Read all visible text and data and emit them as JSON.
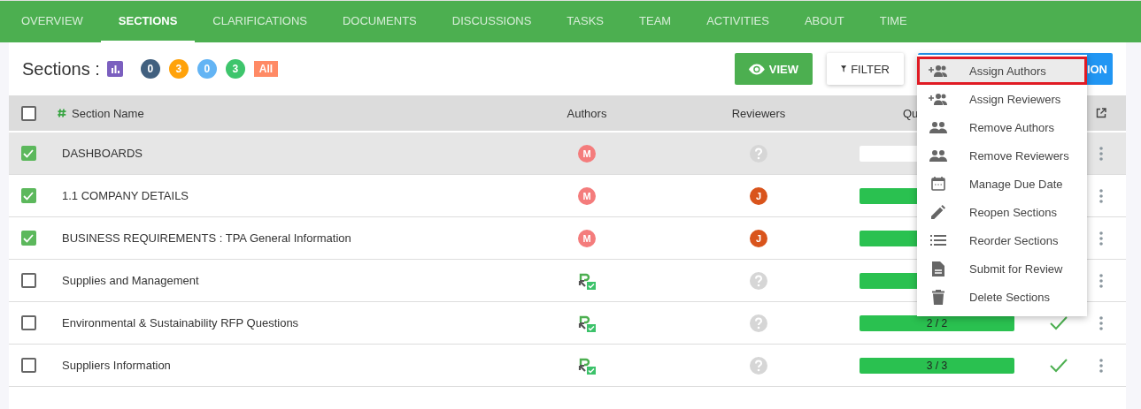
{
  "tabs": [
    {
      "label": "OVERVIEW",
      "selected": false
    },
    {
      "label": "SECTIONS",
      "selected": true
    },
    {
      "label": "CLARIFICATIONS",
      "selected": false
    },
    {
      "label": "DOCUMENTS",
      "selected": false
    },
    {
      "label": "DISCUSSIONS",
      "selected": false
    },
    {
      "label": "TASKS",
      "selected": false
    },
    {
      "label": "TEAM",
      "selected": false
    },
    {
      "label": "ACTIVITIES",
      "selected": false
    },
    {
      "label": "ABOUT",
      "selected": false
    },
    {
      "label": "TIME",
      "selected": false
    }
  ],
  "header": {
    "title": "Sections :",
    "badges": [
      {
        "kind": "count",
        "label": "0",
        "color": "#41607f"
      },
      {
        "kind": "count",
        "label": "3",
        "color": "#ffa20a"
      },
      {
        "kind": "count",
        "label": "0",
        "color": "#63b4f4"
      },
      {
        "kind": "count",
        "label": "3",
        "color": "#3ec56c"
      },
      {
        "kind": "tag",
        "label": "All",
        "color": "#ff8a65"
      }
    ],
    "buttons": [
      {
        "kind": "view",
        "label": "VIEW"
      },
      {
        "kind": "filter",
        "label": "FILTER"
      },
      {
        "kind": "action",
        "label": "ION"
      }
    ]
  },
  "table": {
    "select_all": {
      "checked": false
    },
    "columns": [
      "Section Name",
      "Authors",
      "Reviewers",
      "Qu"
    ],
    "rows": [
      {
        "checked": true,
        "hovered": true,
        "name": "DASHBOARDS",
        "author": {
          "kind": "avatar",
          "initial": "M",
          "color": "#f47c7c"
        },
        "reviewer": {
          "kind": "unknown"
        },
        "progress": {
          "level": 0
        }
      },
      {
        "checked": true,
        "hovered": false,
        "name": "1.1 COMPANY DETAILS",
        "author": {
          "kind": "avatar",
          "initial": "M",
          "color": "#f47c7c"
        },
        "reviewer": {
          "kind": "avatar",
          "initial": "J",
          "color": "#d9541c"
        },
        "progress": {
          "level": 1
        }
      },
      {
        "checked": true,
        "hovered": false,
        "name": "BUSINESS REQUIREMENTS : TPA General Information",
        "author": {
          "kind": "avatar",
          "initial": "M",
          "color": "#f47c7c"
        },
        "reviewer": {
          "kind": "avatar",
          "initial": "J",
          "color": "#d9541c"
        },
        "progress": {
          "level": 1
        }
      },
      {
        "checked": false,
        "hovered": false,
        "name": "Supplies and Management",
        "author": {
          "kind": "assign"
        },
        "reviewer": {
          "kind": "unknown"
        },
        "progress": {
          "level": 1
        }
      },
      {
        "checked": false,
        "hovered": false,
        "name": "Environmental & Sustainability RFP Questions",
        "author": {
          "kind": "assign"
        },
        "reviewer": {
          "kind": "unknown"
        },
        "progress": {
          "level": 1,
          "label": "2 / 2"
        },
        "complete": true
      },
      {
        "checked": false,
        "hovered": false,
        "name": "Suppliers Information",
        "author": {
          "kind": "assign"
        },
        "reviewer": {
          "kind": "unknown"
        },
        "progress": {
          "level": 1,
          "label": "3 / 3"
        },
        "complete": true
      }
    ]
  },
  "menu": {
    "items": [
      {
        "label": "Assign Authors",
        "highlighted": true
      },
      {
        "label": "Assign Reviewers",
        "highlighted": false
      },
      {
        "label": "Remove Authors",
        "highlighted": false
      },
      {
        "label": "Remove Reviewers",
        "highlighted": false
      },
      {
        "label": "Manage Due Date",
        "highlighted": false
      },
      {
        "label": "Reopen Sections",
        "highlighted": false
      },
      {
        "label": "Reorder Sections",
        "highlighted": false
      },
      {
        "label": "Submit for Review",
        "highlighted": false
      },
      {
        "label": "Delete Sections",
        "highlighted": false
      }
    ]
  }
}
